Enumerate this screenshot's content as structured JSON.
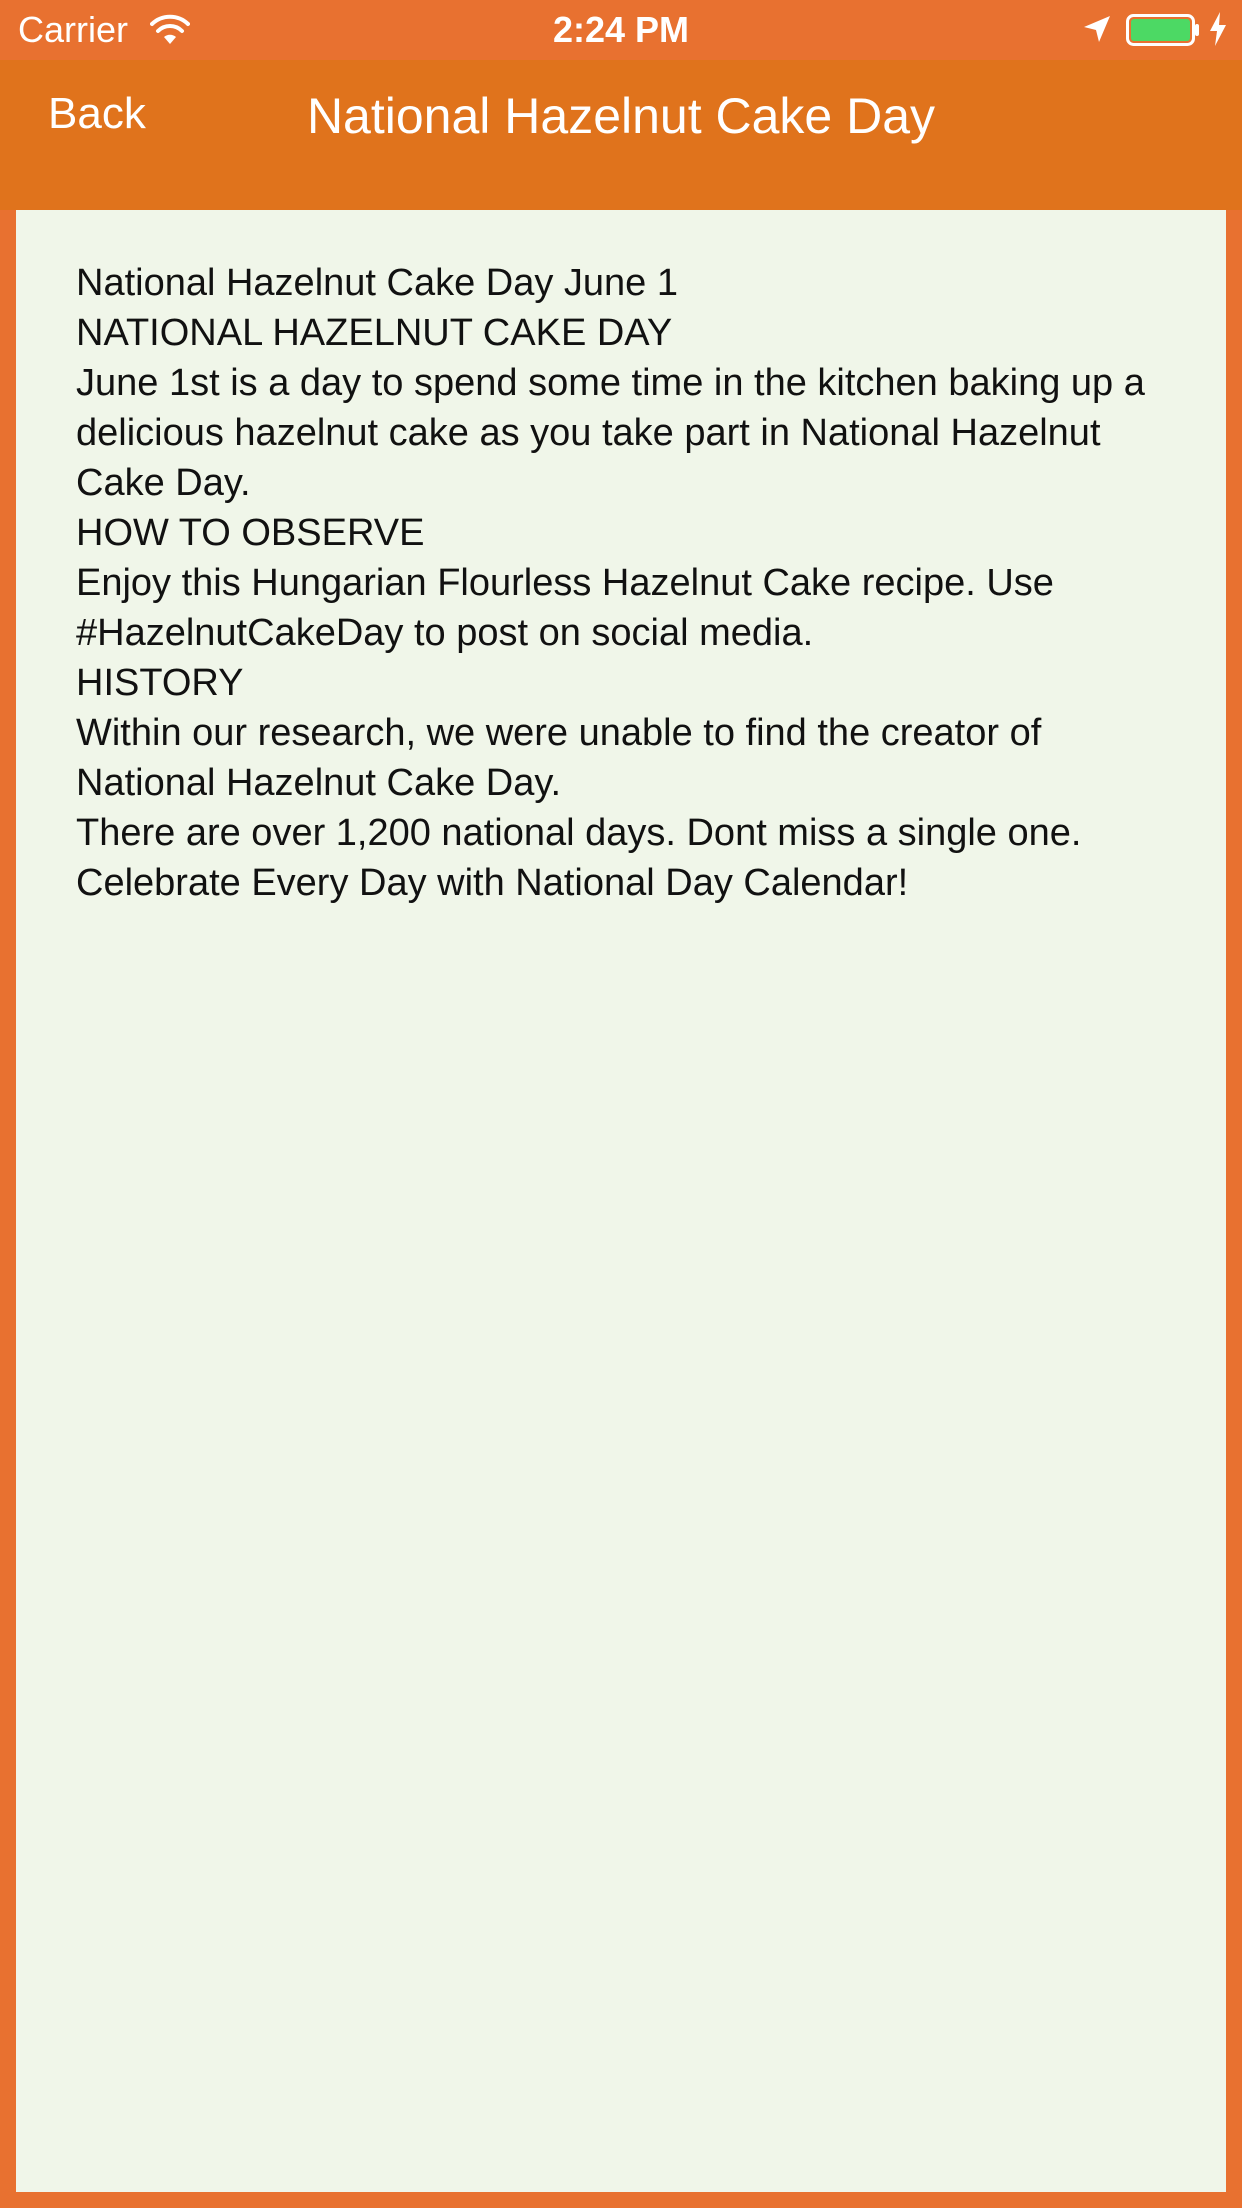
{
  "status_bar": {
    "carrier": "Carrier",
    "time": "2:24 PM",
    "icons": [
      "wifi-icon",
      "location-arrow-icon",
      "battery-icon",
      "charging-bolt-icon"
    ],
    "battery_color": "#4cd964"
  },
  "nav": {
    "back_label": "Back",
    "title": "National Hazelnut Cake Day",
    "background": "#e0731c"
  },
  "content": {
    "text": "National Hazelnut Cake Day June 1\nNATIONAL HAZELNUT CAKE DAY\nJune 1st is a day to spend some time in the kitchen baking up a delicious hazelnut cake as you take part in National Hazelnut Cake Day.\nHOW TO OBSERVE\nEnjoy this Hungarian Flourless Hazelnut Cake recipe. Use #HazelnutCakeDay to post on social media.\nHISTORY\nWithin our research, we were unable to find the creator of National Hazelnut Cake Day.\nThere are over 1,200 national days. Dont miss a single one. Celebrate Every Day with National Day Calendar!",
    "background": "#f0f6e9"
  },
  "colors": {
    "frame": "#e87130",
    "accent": "#e0731c"
  }
}
